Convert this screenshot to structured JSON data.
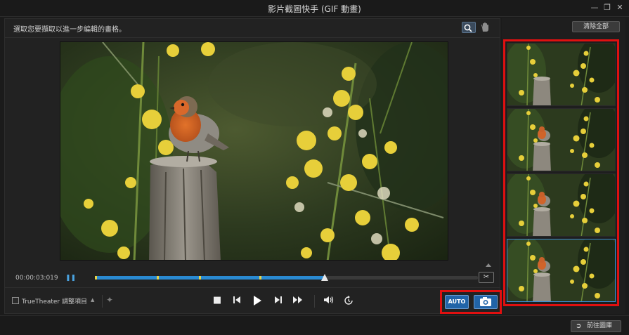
{
  "window": {
    "title": "影片截圖快手 (GIF 動畫)"
  },
  "editor": {
    "hint": "選取您要擷取以進一步編輯的畫格。",
    "timecode": "00:00:03:019",
    "progress": 0.6
  },
  "controls": {
    "truetheater_label": "TrueTheater 調整項目",
    "auto_label": "AUTO"
  },
  "sidebar": {
    "clear_all_label": "清除全部",
    "thumbnail_count": 4,
    "selected_index": 3
  },
  "footer": {
    "go_to_gallery_label": "前往圖庫"
  },
  "icons": {
    "minimize": "minimize-icon",
    "restore": "restore-icon",
    "close": "close-icon",
    "zoom": "zoom-icon",
    "hand": "hand-icon",
    "cut": "scissors-icon",
    "stop": "stop-icon",
    "prev": "previous-frame-icon",
    "play": "play-icon",
    "next": "next-frame-icon",
    "fast_forward": "fast-forward-icon",
    "volume": "volume-icon",
    "loop": "loop-icon",
    "camera": "camera-icon",
    "export": "export-icon"
  },
  "colors": {
    "accent": "#2a8ad2",
    "highlight": "#e01010",
    "marker": "#e4d24a"
  }
}
